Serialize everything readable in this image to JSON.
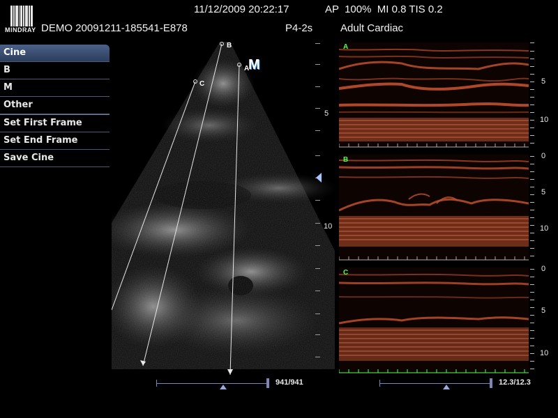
{
  "header": {
    "logo_text": "MINDRAY",
    "datetime": "11/12/2009 20:22:17",
    "power_info": "AP  100%  MI 0.8 TIS 0.2",
    "patient_id": "DEMO 20091211-185541-E878",
    "probe": "P4-2s",
    "exam_type": "Adult Cardiac"
  },
  "menu": {
    "items": [
      {
        "label": "Cine",
        "active": true
      },
      {
        "label": "B"
      },
      {
        "label": "M"
      },
      {
        "label": "Other"
      },
      {
        "label": "Set First Frame"
      },
      {
        "label": "Set End Frame"
      },
      {
        "label": "Save Cine"
      }
    ]
  },
  "bmode": {
    "depth_labels": [
      "5",
      "10"
    ],
    "cursor_labels": {
      "a": "A",
      "b": "B",
      "c": "C"
    },
    "mode_icon": "M",
    "frame_counter": "941/941",
    "focus_marker": "triangle-left-icon"
  },
  "mmode": {
    "panels": [
      {
        "label": "A",
        "scale": [
          "5",
          "10"
        ]
      },
      {
        "label": "B",
        "scale": [
          "0",
          "5",
          "10"
        ]
      },
      {
        "label": "C",
        "scale": [
          "0",
          "5",
          "10"
        ]
      }
    ],
    "time_counter": "12.3/12.3"
  },
  "colors": {
    "mmode_tissue": "#c0502e",
    "menu_active": "#3c5078",
    "panel_label": "#4cff4c",
    "slider": "#7d86b8"
  }
}
